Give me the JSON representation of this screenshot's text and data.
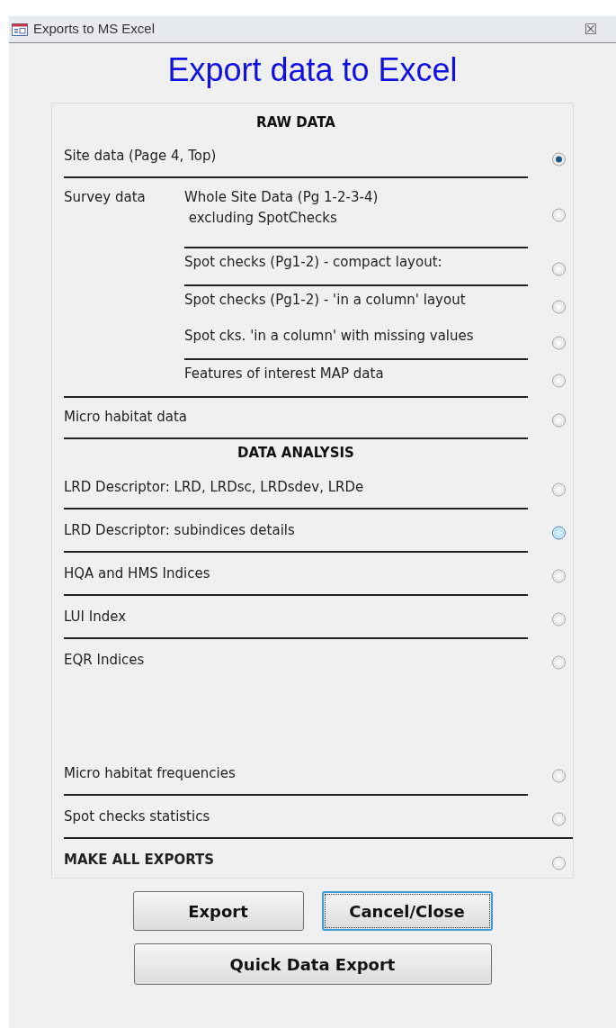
{
  "window": {
    "title": "Exports to MS Excel",
    "close": "☒"
  },
  "heading": "Export data to Excel",
  "sections": [
    {
      "heading": "RAW DATA",
      "items": [
        {
          "kind": "option",
          "label": "Site data (Page 4, Top)",
          "selected": true,
          "highlighted": false,
          "ruled": true
        },
        {
          "kind": "group",
          "label": "Survey data",
          "options": [
            {
              "label": "Whole Site Data (Pg 1-2-3-4)\n excluding SpotChecks",
              "selected": false,
              "highlighted": false,
              "ruled": true
            },
            {
              "label": "Spot checks (Pg1-2) - compact layout:",
              "selected": false,
              "highlighted": false,
              "ruled": true
            },
            {
              "label": "Spot checks (Pg1-2) - 'in a column' layout",
              "selected": false,
              "highlighted": false,
              "ruled": false
            },
            {
              "label": "Spot cks. 'in a column' with missing values",
              "selected": false,
              "highlighted": false,
              "ruled": true
            },
            {
              "label": "Features of interest MAP data",
              "selected": false,
              "highlighted": false,
              "ruled": false
            }
          ],
          "ruled": true
        },
        {
          "kind": "option",
          "label": "Micro habitat data",
          "selected": false,
          "highlighted": false,
          "ruled": true
        }
      ]
    },
    {
      "heading": "DATA ANALYSIS",
      "items": [
        {
          "kind": "option",
          "label": "LRD Descriptor: LRD, LRDsc, LRDsdev, LRDe",
          "selected": false,
          "highlighted": false,
          "ruled": true
        },
        {
          "kind": "option",
          "label": "LRD Descriptor: subindices details",
          "selected": false,
          "highlighted": true,
          "ruled": true
        },
        {
          "kind": "option",
          "label": "HQA and HMS Indices",
          "selected": false,
          "highlighted": false,
          "ruled": true
        },
        {
          "kind": "option",
          "label": "LUI Index",
          "selected": false,
          "highlighted": false,
          "ruled": true
        },
        {
          "kind": "option",
          "label": "EQR Indices",
          "selected": false,
          "highlighted": false,
          "ruled": false
        }
      ]
    },
    {
      "items": [
        {
          "kind": "option",
          "label": "Micro habitat frequencies",
          "selected": false,
          "highlighted": false,
          "ruled": true
        },
        {
          "kind": "option",
          "label": "Spot checks statistics",
          "selected": false,
          "highlighted": false,
          "ruled": true
        }
      ]
    },
    {
      "items": [
        {
          "kind": "strong",
          "label": "MAKE ALL EXPORTS",
          "selected": false,
          "highlighted": false,
          "ruled": false
        }
      ]
    }
  ],
  "buttons": [
    {
      "label": "Export",
      "focused": false
    },
    {
      "label": "Cancel/Close",
      "focused": true
    },
    {
      "label": "Quick Data Export",
      "focused": false
    }
  ]
}
